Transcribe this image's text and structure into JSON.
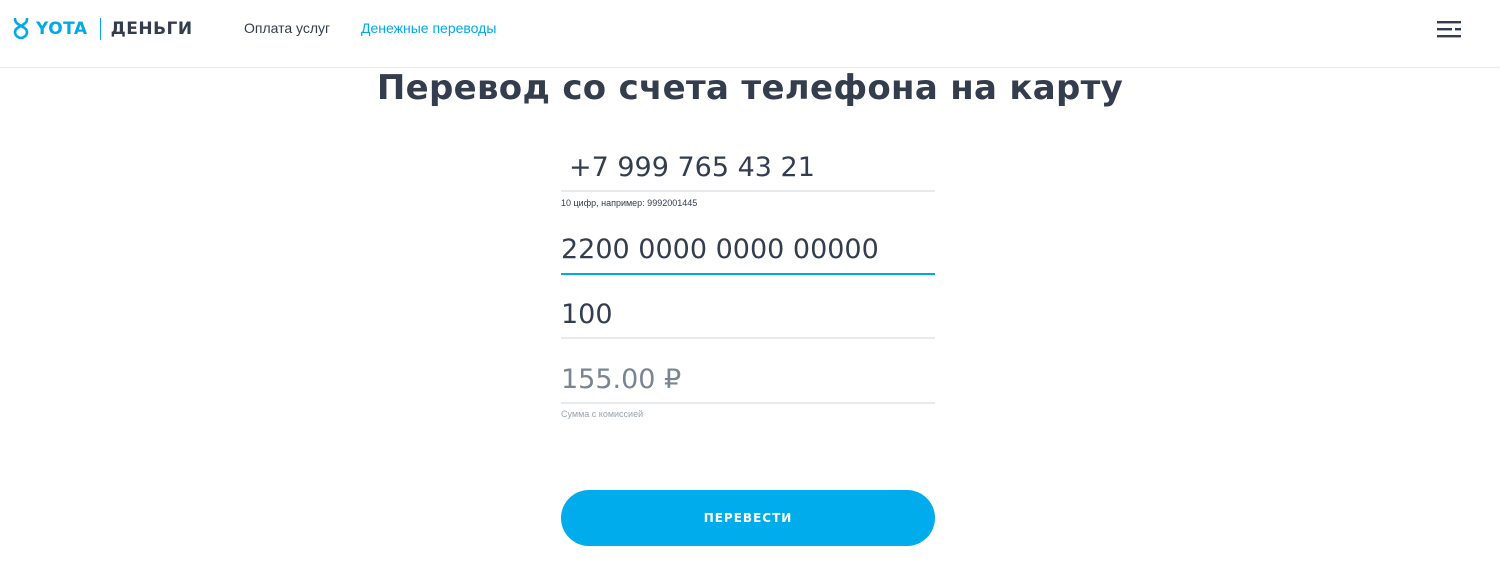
{
  "header": {
    "logo_brand": "YOTA",
    "logo_service": "ДЕНЬГИ",
    "nav": [
      {
        "label": "Оплата услуг"
      },
      {
        "label": "Денежные переводы"
      }
    ]
  },
  "title": "Перевод со счета телефона на карту",
  "form": {
    "phone_value": "+7 999 765 43 21",
    "phone_hint": "10 цифр, например: 9992001445",
    "card_value": "2200 0000 0000 00000",
    "amount_value": "100",
    "total_value": "155.00 ₽",
    "total_hint": "Сумма с комиссией",
    "submit_label": "ПЕРЕВЕСТИ"
  },
  "colors": {
    "accent": "#00a9e8",
    "text": "#333d4d",
    "button": "#00aceb"
  }
}
